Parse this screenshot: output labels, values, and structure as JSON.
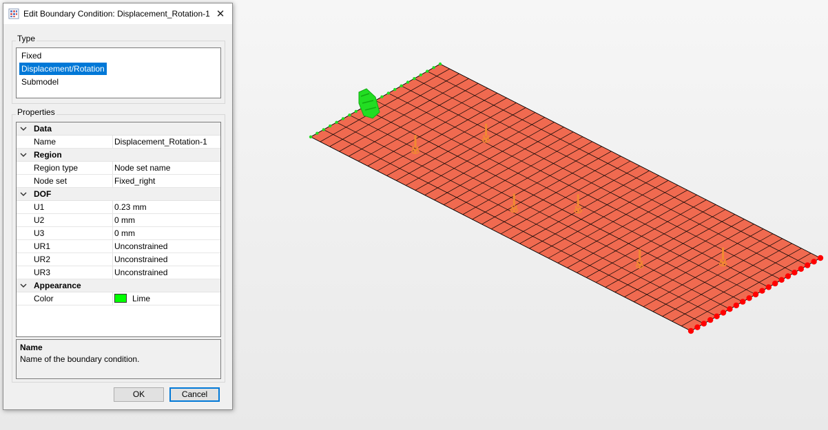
{
  "dialog": {
    "title": "Edit Boundary Condition: Displacement_Rotation-1",
    "close_glyph": "✕",
    "type_group_label": "Type",
    "type_options": [
      "Fixed",
      "Displacement/Rotation",
      "Submodel"
    ],
    "type_selected": "Displacement/Rotation",
    "properties_group_label": "Properties",
    "categories": {
      "data": "Data",
      "region": "Region",
      "dof": "DOF",
      "appearance": "Appearance"
    },
    "properties": {
      "name": {
        "label": "Name",
        "value": "Displacement_Rotation-1"
      },
      "region_type": {
        "label": "Region type",
        "value": "Node set name"
      },
      "node_set": {
        "label": "Node set",
        "value": "Fixed_right"
      },
      "u1": {
        "label": "U1",
        "value": "0.23 mm"
      },
      "u2": {
        "label": "U2",
        "value": "0 mm"
      },
      "u3": {
        "label": "U3",
        "value": "0 mm"
      },
      "ur1": {
        "label": "UR1",
        "value": "Unconstrained"
      },
      "ur2": {
        "label": "UR2",
        "value": "Unconstrained"
      },
      "ur3": {
        "label": "UR3",
        "value": "Unconstrained"
      },
      "color": {
        "label": "Color",
        "value": "Lime",
        "swatch": "#00ff00"
      }
    },
    "description": {
      "title": "Name",
      "text": "Name of the boundary condition."
    },
    "buttons": {
      "ok": "OK",
      "cancel": "Cancel"
    }
  },
  "viewport": {
    "plate_color": "#f06a50",
    "mesh_line_color": "#000000",
    "fixed_nodes_color": "#ff0000",
    "bc_nodes_color": "#22dd22",
    "load_arrow_color": "#f08a30",
    "mesh_divisions": {
      "long": 40,
      "short": 10
    }
  }
}
